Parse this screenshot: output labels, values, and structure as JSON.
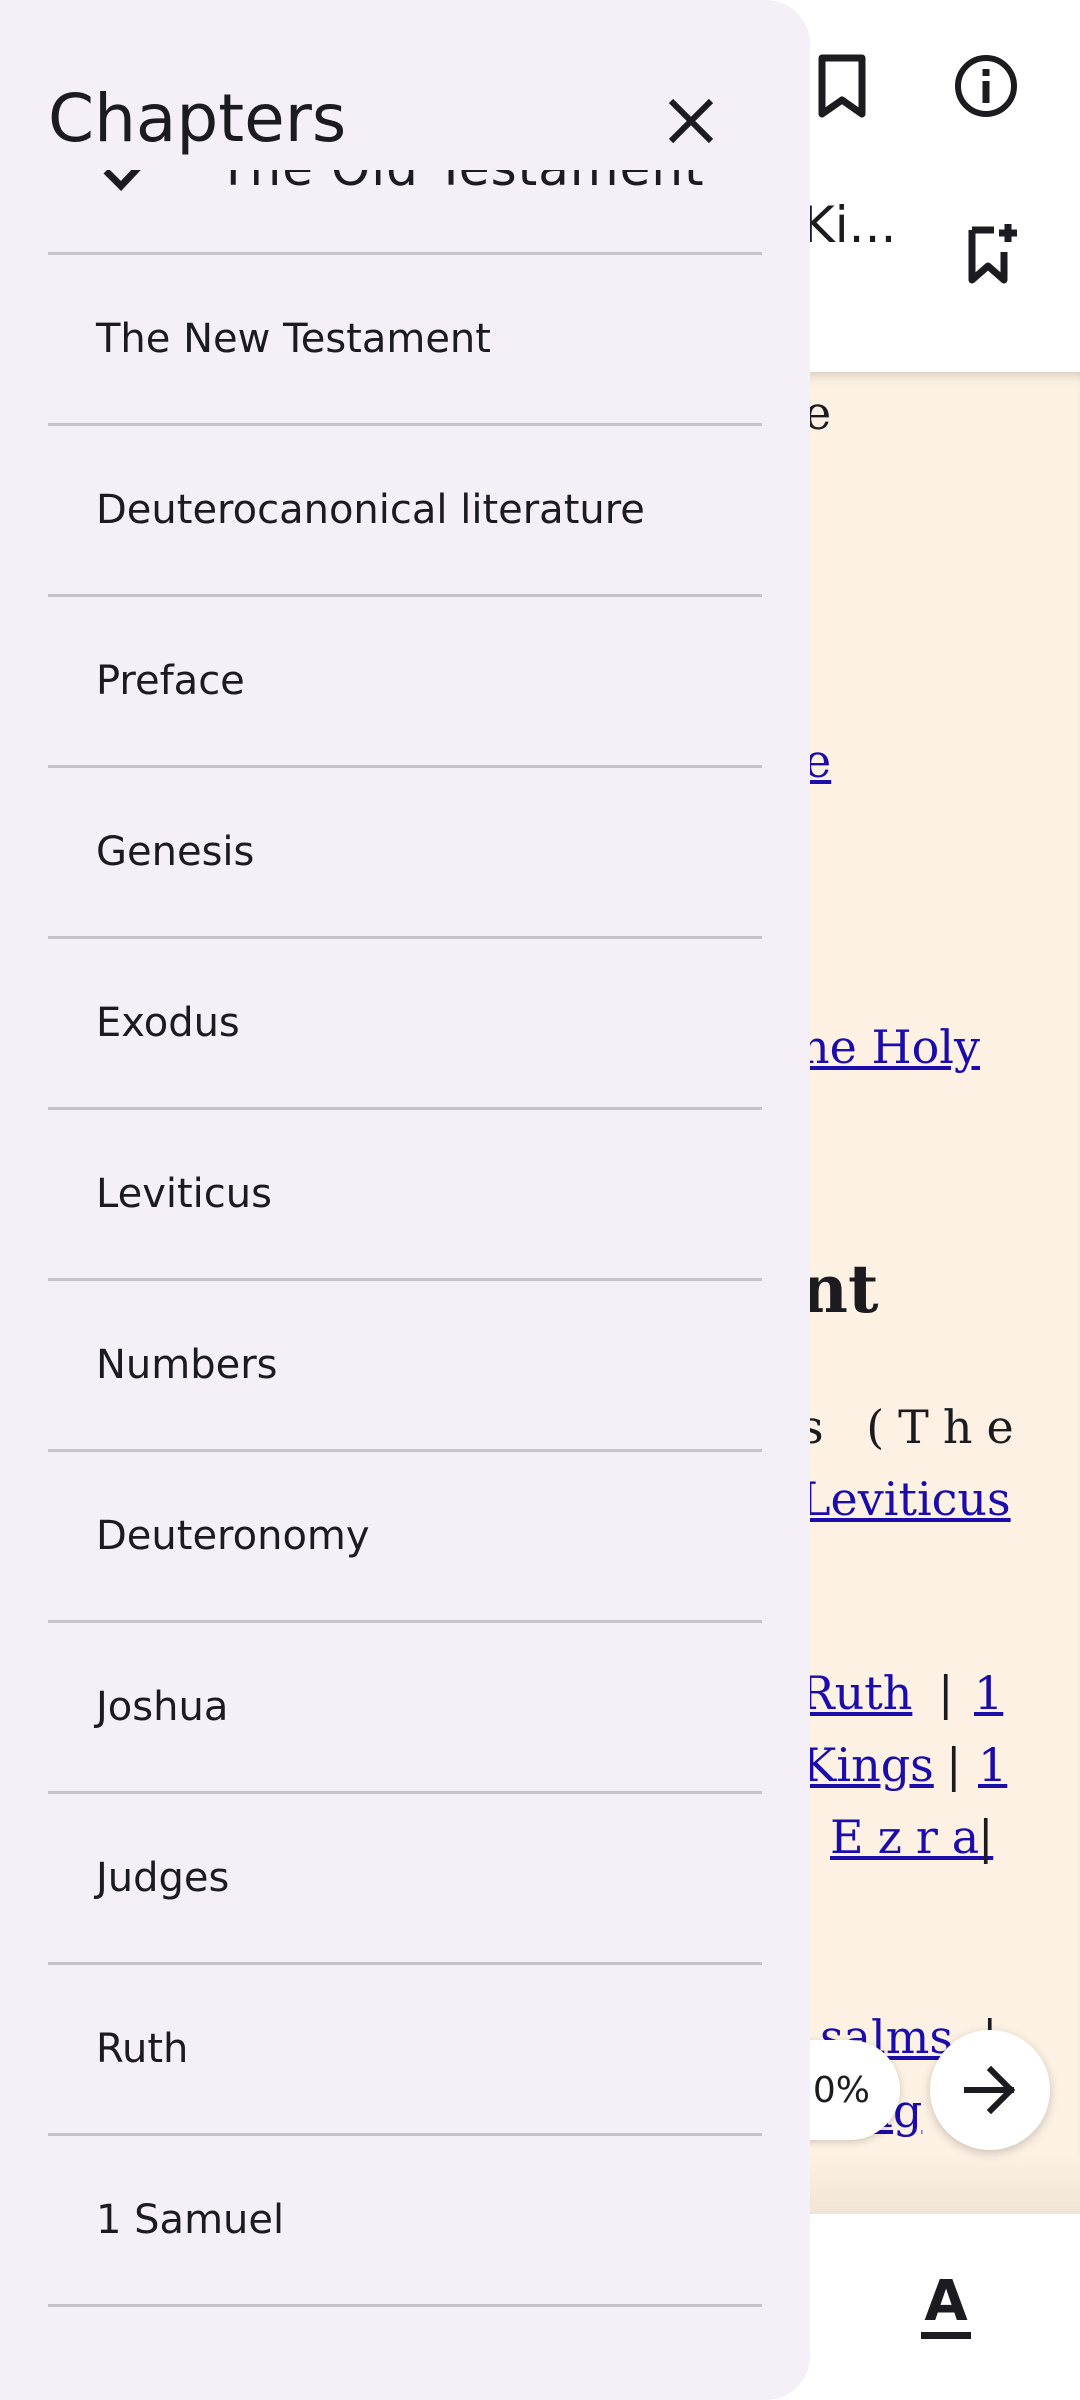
{
  "reader": {
    "book_title": "Ki...",
    "progress": "0%",
    "fragments": {
      "f1": "e",
      "f2": "e",
      "f3": "he Holy ",
      "f4": "nt",
      "f5": "s (The",
      "f6": "Leviticus ",
      "f7": "Ruth ",
      "f8": "|",
      "f9": "1 ",
      "f10": "Kings ",
      "f11": "|",
      "f12": "1 ",
      "f13": "Ezra ",
      "f14": "|",
      "f15": "salms",
      "f16": "|",
      "f17": "Song "
    }
  },
  "drawer": {
    "title": "Chapters",
    "selected_chapter": "The Old Testament",
    "chapters": [
      "The New Testament",
      "Deuterocanonical literature",
      "Preface",
      "Genesis",
      "Exodus",
      "Leviticus",
      "Numbers",
      "Deuteronomy",
      "Joshua",
      "Judges",
      "Ruth",
      "1 Samuel"
    ]
  },
  "icons": {
    "bookmark": "bookmark-icon",
    "info": "info-icon",
    "add_bookmark": "bookmark-add-icon",
    "next": "arrow-right-icon",
    "font": "text-format-icon",
    "close": "close-icon",
    "check": "check-icon"
  },
  "colors": {
    "drawer_bg": "#f5f0f7",
    "page_bg": "#fdf1e3",
    "link": "#1a0dab",
    "divider": "#c6c4ca"
  }
}
